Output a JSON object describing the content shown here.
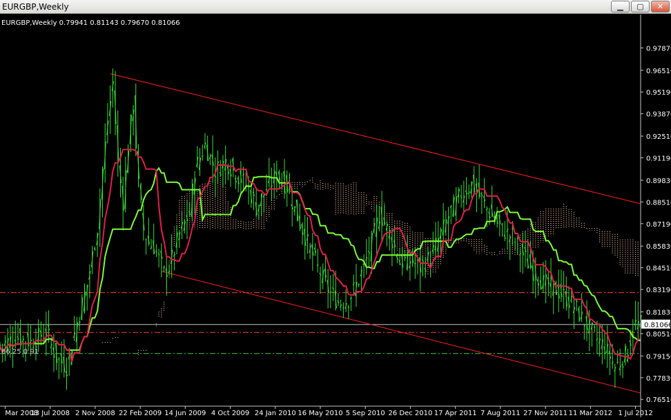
{
  "window": {
    "title": "EURGBP,Weekly",
    "buttons": {
      "minimize": "▁",
      "restore": "▢",
      "close": "✕"
    }
  },
  "chart_data": {
    "type": "candlestick",
    "title": "EURGBP,Weekly",
    "info": "EURGBP,Weekly  0.79941 0.81143 0.79670 0.81066",
    "symbol": "EURGBP",
    "timeframe": "Weekly",
    "ohlc": {
      "open": 0.79941,
      "high": 0.81143,
      "low": 0.7967,
      "close": 0.81066
    },
    "current_price_label": "0.81066",
    "ylim": [
      0.761,
      0.999
    ],
    "y_ticks": [
      "0.97870",
      "0.96510",
      "0.95190",
      "0.93870",
      "0.92510",
      "0.91190",
      "0.89830",
      "0.88510",
      "0.87190",
      "0.85830",
      "0.84510",
      "0.83190",
      "0.81830",
      "0.80510",
      "0.79150",
      "0.77830",
      "0.76510"
    ],
    "x_ticks": [
      "Mar 2008",
      "13 Jul 2008",
      "2 Nov 2008",
      "22 Feb 2009",
      "14 Jun 2009",
      "4 Oct 2009",
      "24 Jan 2010",
      "16 May 2010",
      "5 Sep 2010",
      "26 Dec 2010",
      "17 Apr 2011",
      "7 Aug 2011",
      "27 Nov 2011",
      "11 Mar 2012",
      "1 Jul 2012"
    ],
    "fib_label": "66.25  0.91",
    "horizontal_levels": [
      {
        "value": 0.83,
        "style": "dashdot",
        "color": "#ff3b30"
      },
      {
        "value": 0.8058,
        "style": "dashdot",
        "color": "#ff3b30"
      },
      {
        "value": 0.793,
        "style": "dashdot",
        "color": "#44cc44"
      },
      {
        "value": 0.81066,
        "style": "solid",
        "color": "#c8c8c8"
      }
    ],
    "channel_lines": [
      {
        "name": "upper",
        "from": {
          "week": 43,
          "price": 0.963
        },
        "to": {
          "week": 250,
          "price": 0.884
        }
      },
      {
        "name": "lower",
        "from": {
          "week": 63,
          "price": 0.843
        },
        "to": {
          "week": 250,
          "price": 0.769
        }
      }
    ],
    "week_range": [
      0,
      250
    ],
    "close_series": [
      [
        0,
        0.798
      ],
      [
        6,
        0.803
      ],
      [
        12,
        0.8
      ],
      [
        18,
        0.806
      ],
      [
        22,
        0.79
      ],
      [
        26,
        0.785
      ],
      [
        30,
        0.812
      ],
      [
        34,
        0.835
      ],
      [
        38,
        0.87
      ],
      [
        40,
        0.905
      ],
      [
        42,
        0.935
      ],
      [
        44,
        0.958
      ],
      [
        46,
        0.908
      ],
      [
        48,
        0.885
      ],
      [
        50,
        0.92
      ],
      [
        52,
        0.945
      ],
      [
        54,
        0.895
      ],
      [
        56,
        0.868
      ],
      [
        58,
        0.86
      ],
      [
        60,
        0.858
      ],
      [
        62,
        0.85
      ],
      [
        64,
        0.842
      ],
      [
        66,
        0.846
      ],
      [
        68,
        0.856
      ],
      [
        70,
        0.866
      ],
      [
        72,
        0.872
      ],
      [
        74,
        0.878
      ],
      [
        76,
        0.905
      ],
      [
        80,
        0.92
      ],
      [
        84,
        0.904
      ],
      [
        88,
        0.91
      ],
      [
        92,
        0.902
      ],
      [
        96,
        0.896
      ],
      [
        100,
        0.882
      ],
      [
        104,
        0.893
      ],
      [
        108,
        0.902
      ],
      [
        112,
        0.894
      ],
      [
        116,
        0.876
      ],
      [
        120,
        0.86
      ],
      [
        124,
        0.845
      ],
      [
        128,
        0.832
      ],
      [
        132,
        0.824
      ],
      [
        136,
        0.826
      ],
      [
        140,
        0.838
      ],
      [
        144,
        0.855
      ],
      [
        148,
        0.878
      ],
      [
        152,
        0.866
      ],
      [
        156,
        0.848
      ],
      [
        160,
        0.85
      ],
      [
        164,
        0.845
      ],
      [
        168,
        0.852
      ],
      [
        172,
        0.866
      ],
      [
        176,
        0.88
      ],
      [
        180,
        0.89
      ],
      [
        184,
        0.896
      ],
      [
        188,
        0.886
      ],
      [
        192,
        0.876
      ],
      [
        196,
        0.868
      ],
      [
        200,
        0.864
      ],
      [
        204,
        0.853
      ],
      [
        208,
        0.843
      ],
      [
        212,
        0.836
      ],
      [
        216,
        0.833
      ],
      [
        220,
        0.828
      ],
      [
        224,
        0.822
      ],
      [
        228,
        0.812
      ],
      [
        232,
        0.804
      ],
      [
        236,
        0.797
      ],
      [
        240,
        0.785
      ],
      [
        244,
        0.792
      ],
      [
        248,
        0.811
      ]
    ],
    "tenkan_color": "#e0204a",
    "kijun_color": "#7fff3a",
    "price_color": "#38e038",
    "cloud_color": "#ffc8a8",
    "channel_color": "#ff2020"
  }
}
